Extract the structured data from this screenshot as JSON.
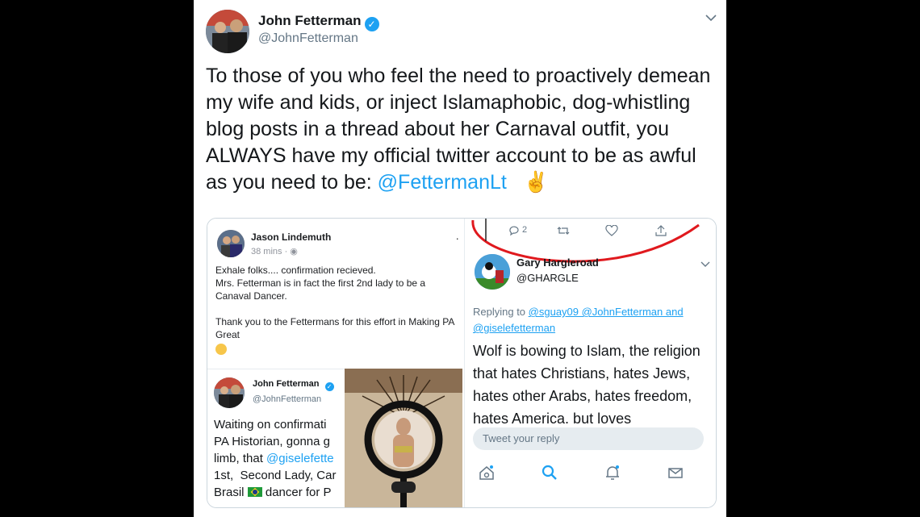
{
  "tweet": {
    "author_name": "John Fetterman",
    "verified_glyph": "✓",
    "handle": "@JohnFetterman",
    "menu_icon": "chevron-down-icon",
    "text_before_link": "To those of you who feel the need to proactively demean my wife and kids, or inject Islamaphobic, dog-whistling blog posts in a thread about her Carnaval outfit, you ALWAYS have my official twitter account to be as awful as you need to be:  ",
    "mention": "@FettermanLt",
    "emoji": "✌️",
    "colors": {
      "accent": "#1da1f2",
      "text": "#14171a",
      "muted": "#657786"
    }
  },
  "embedded": {
    "facebook_post": {
      "author": "Jason Lindemuth",
      "time": "38 mins · ",
      "globe_icon": "globe-icon",
      "more_dot": "·",
      "lines": [
        "Exhale folks.... confirmation recieved.",
        "Mrs. Fetterman is in fact the first 2nd lady to be a Canaval Dancer.",
        "",
        "Thank you to the Fettermans for this effort in Making PA Great"
      ]
    },
    "inner_tweet": {
      "author": "John Fetterman",
      "handle": "@JohnFetterman",
      "line1": "Waiting on confirmati",
      "line2": "PA Historian, gonna g",
      "line3_prefix": "limb, that ",
      "line3_mention": "@giselefette",
      "line4": "1st,  Second Lady, Car",
      "line5_prefix": "Brasil ",
      "line5_suffix": " dancer for P"
    },
    "reply_tweet": {
      "reply_count": "2",
      "author": "Gary Hargleroad",
      "handle": "@GHARGLE",
      "replying_prefix": "Replying to ",
      "replying_mentions": "@sguay09 @JohnFetterman and @giselefetterman",
      "body": "Wolf is bowing to Islam, the religion that hates Christians, hates Jews, hates other Arabs, hates freedom, hates America, but loves",
      "reply_placeholder": "Tweet your reply"
    },
    "highlight_color": "#e0191e"
  }
}
